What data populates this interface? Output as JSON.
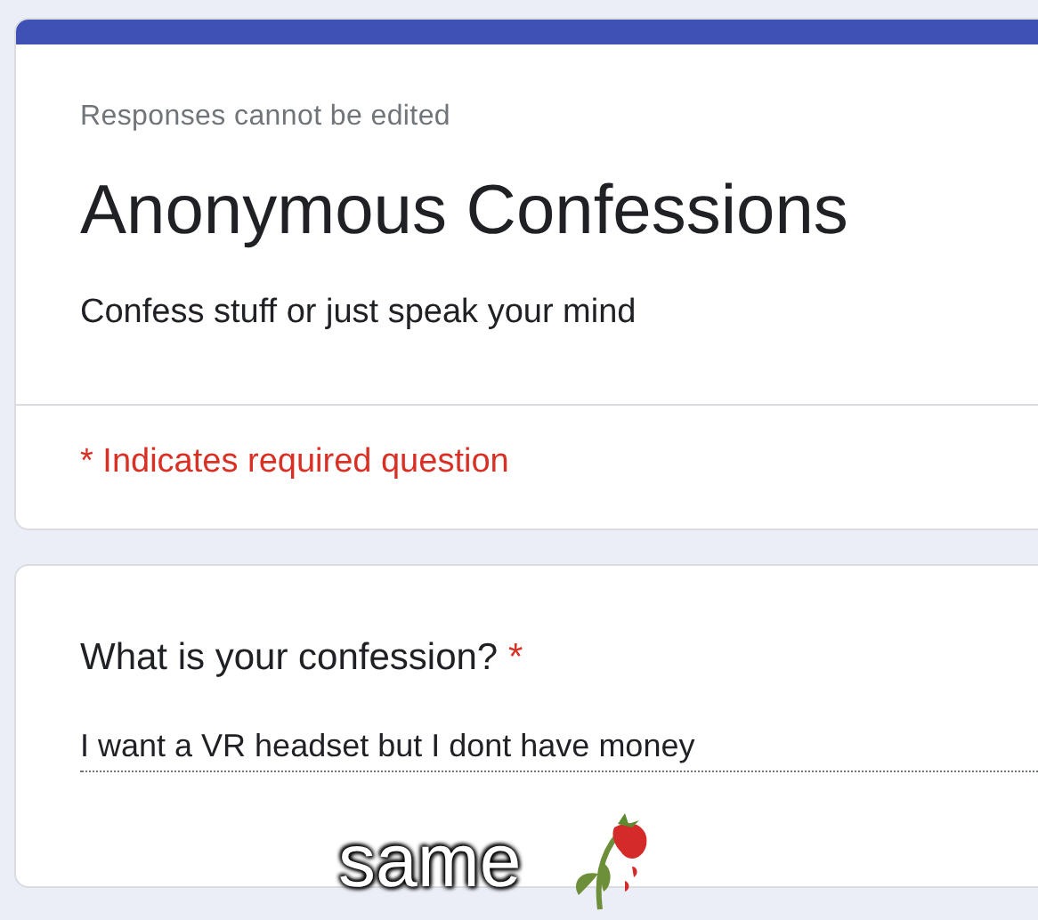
{
  "form": {
    "notice": "Responses cannot be edited",
    "title": "Anonymous Confessions",
    "description": "Confess stuff or just speak your mind",
    "required_note": "* Indicates required question"
  },
  "questions": [
    {
      "label": "What is your confession?",
      "required": true,
      "required_mark": "*",
      "answer": "I want a VR headset but I dont have money"
    }
  ],
  "caption": {
    "text": "same"
  }
}
